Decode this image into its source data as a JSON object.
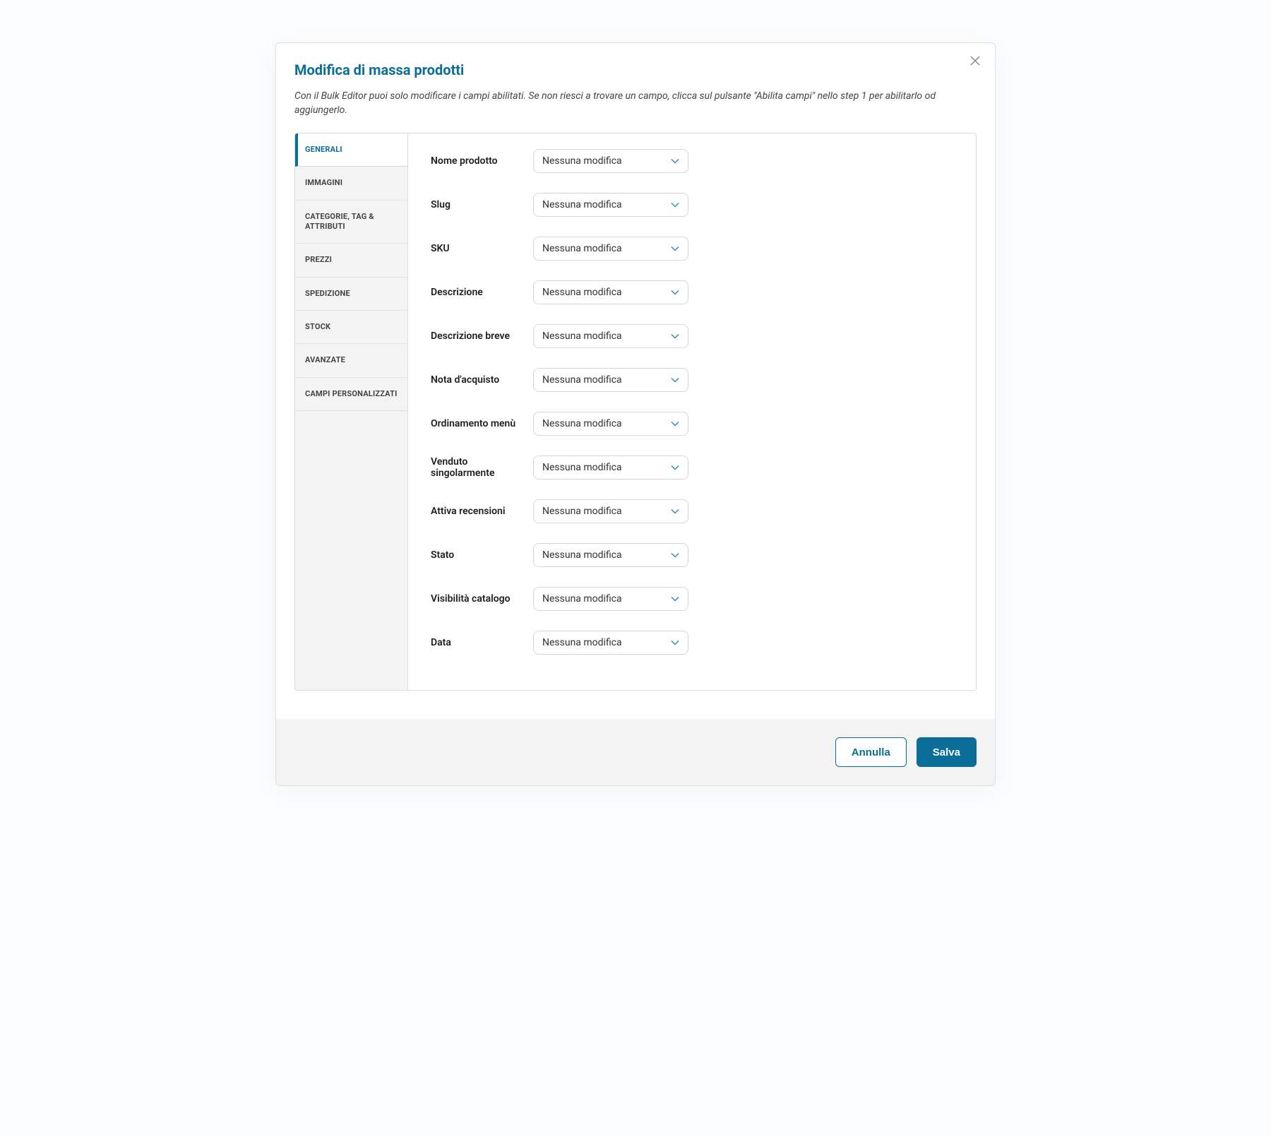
{
  "modal": {
    "title": "Modifica di massa prodotti",
    "description": "Con il Bulk Editor puoi solo modificare i campi abilitati. Se non riesci a trovare un campo, clicca sul pulsante \"Abilita campi\" nello step 1 per abilitarlo od aggiungerlo."
  },
  "tabs": {
    "generali": "GENERALI",
    "immagini": "IMMAGINI",
    "categorie": "CATEGORIE, TAG & ATTRIBUTI",
    "prezzi": "PREZZI",
    "spedizione": "SPEDIZIONE",
    "stock": "STOCK",
    "avanzate": "AVANZATE",
    "campi": "CAMPI PERSONALIZZATI"
  },
  "select_default": "Nessuna modifica",
  "fields": {
    "nome_prodotto": {
      "label": "Nome prodotto",
      "value": "Nessuna modifica"
    },
    "slug": {
      "label": "Slug",
      "value": "Nessuna modifica"
    },
    "sku": {
      "label": "SKU",
      "value": "Nessuna modifica"
    },
    "descrizione": {
      "label": "Descrizione",
      "value": "Nessuna modifica"
    },
    "descrizione_breve": {
      "label": "Descrizione breve",
      "value": "Nessuna modifica"
    },
    "nota_acquisto": {
      "label": "Nota d'acquisto",
      "value": "Nessuna modifica"
    },
    "ordinamento_menu": {
      "label": "Ordinamento menù",
      "value": "Nessuna modifica"
    },
    "venduto_singolarmente": {
      "label": "Venduto singolarmente",
      "value": "Nessuna modifica"
    },
    "attiva_recensioni": {
      "label": "Attiva recensioni",
      "value": "Nessuna modifica"
    },
    "stato": {
      "label": "Stato",
      "value": "Nessuna modifica"
    },
    "visibilita_catalogo": {
      "label": "Visibilità catalogo",
      "value": "Nessuna modifica"
    },
    "data": {
      "label": "Data",
      "value": "Nessuna modifica"
    }
  },
  "footer": {
    "cancel": "Annulla",
    "save": "Salva"
  }
}
